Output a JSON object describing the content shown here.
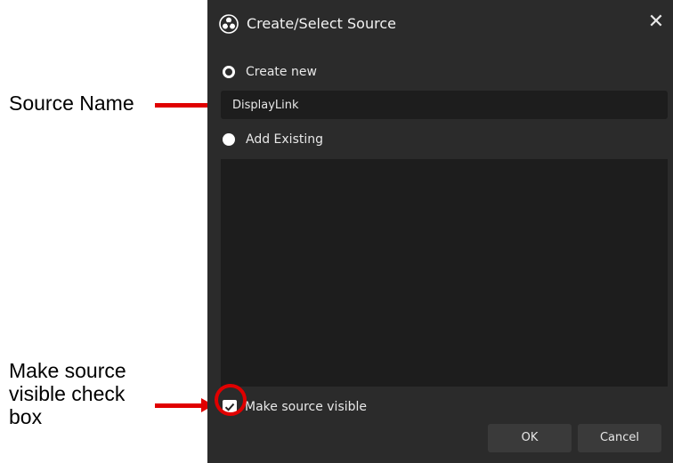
{
  "annotations": {
    "source_name": "Source Name",
    "visible_checkbox": "Make source visible check box"
  },
  "dialog": {
    "title": "Create/Select Source",
    "close_glyph": "✕",
    "create_new_label": "Create new",
    "source_name_value": "DisplayLink",
    "add_existing_label": "Add Existing",
    "existing_sources": [],
    "make_visible_label": "Make source visible",
    "make_visible_checked": true,
    "ok_label": "OK",
    "cancel_label": "Cancel"
  },
  "colors": {
    "dialog_bg": "#2b2b2b",
    "field_bg": "#1d1d1d",
    "button_bg": "#3a3a3a",
    "annotation_red": "#e00000"
  },
  "icons": {
    "app": "obs-logo-icon",
    "close": "close-icon",
    "check": "checkmark-icon"
  }
}
